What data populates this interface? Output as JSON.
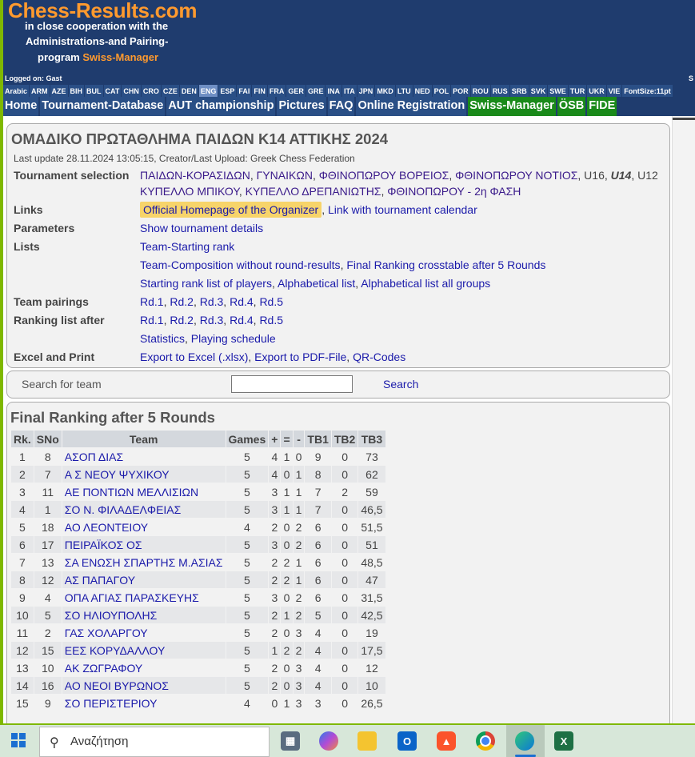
{
  "header": {
    "logo": "Chess-Results.com",
    "coop_line1": "in close cooperation with the",
    "coop_line2": "Administrations-and Pairing-",
    "coop_line3_pre": "program",
    "coop_line3_sm": "Swiss-Manager"
  },
  "login": {
    "left": "Logged on: Gast",
    "right": "S"
  },
  "languages": [
    "Arabic",
    "ARM",
    "AZE",
    "BIH",
    "BUL",
    "CAT",
    "CHN",
    "CRO",
    "CZE",
    "DEN",
    "ENG",
    "ESP",
    "FAI",
    "FIN",
    "FRA",
    "GER",
    "GRE",
    "INA",
    "ITA",
    "JPN",
    "MKD",
    "LTU",
    "NED",
    "POL",
    "POR",
    "ROU",
    "RUS",
    "SRB",
    "SVK",
    "SWE",
    "TUR",
    "UKR",
    "VIE",
    "FontSize:11pt"
  ],
  "active_language": "ENG",
  "nav": [
    {
      "label": "Home",
      "green": false
    },
    {
      "label": "Tournament-Database",
      "green": false
    },
    {
      "label": "AUT championship",
      "green": false
    },
    {
      "label": "Pictures",
      "green": false
    },
    {
      "label": "FAQ",
      "green": false
    },
    {
      "label": "Online Registration",
      "green": false
    },
    {
      "label": "Swiss-Manager",
      "green": true
    },
    {
      "label": "ÖSB",
      "green": true
    },
    {
      "label": "FIDE",
      "green": true
    }
  ],
  "tournament": {
    "title": "ΟΜΑΔΙΚΟ ΠΡΩΤΑΘΛΗΜΑ ΠΑΙΔΩΝ Κ14 ΑΤΤΙΚΗΣ 2024",
    "last_update": "Last update 28.11.2024 13:05:15, Creator/Last Upload: Greek Chess Federation",
    "labels": {
      "selection": "Tournament selection",
      "links": "Links",
      "parameters": "Parameters",
      "lists": "Lists",
      "pairings": "Team pairings",
      "ranking": "Ranking list after",
      "excel": "Excel and Print"
    },
    "selection_line1": [
      "ΠΑΙΔΩΝ-ΚΟΡΑΣΙΔΩΝ",
      "ΓΥΝΑΙΚΩΝ",
      "ΦΘΙΝΟΠΩΡΟΥ ΒΟΡΕΙΟΣ",
      "ΦΘΙΝΟΠΩΡΟΥ ΝΟΤΙΟΣ",
      "U16",
      "U14",
      "U12"
    ],
    "selection_line2": [
      "ΚΥΠΕΛΛΟ ΜΠΙΚΟΥ",
      "ΚΥΠΕΛΛΟ ΔΡΕΠΑΝΙΩΤΗΣ",
      "ΦΘΙΝΟΠΩΡΟΥ - 2η ΦΑΣΗ"
    ],
    "links": [
      "Official Homepage of the Organizer",
      "Link with tournament calendar"
    ],
    "parameters": "Show tournament details",
    "lists_line1": "Team-Starting rank",
    "lists_line2": [
      "Team-Composition without round-results",
      "Final Ranking crosstable after 5 Rounds"
    ],
    "lists_line3": [
      "Starting rank list of players",
      "Alphabetical list",
      "Alphabetical list all groups"
    ],
    "pairings": [
      "Rd.1",
      "Rd.2",
      "Rd.3",
      "Rd.4",
      "Rd.5"
    ],
    "ranking": [
      "Rd.1",
      "Rd.2",
      "Rd.3",
      "Rd.4",
      "Rd.5"
    ],
    "ranking_line2": [
      "Statistics",
      "Playing schedule"
    ],
    "excel": [
      "Export to Excel (.xlsx)",
      "Export to PDF-File",
      "QR-Codes"
    ]
  },
  "search": {
    "label": "Search for team",
    "value": "",
    "button": "Search"
  },
  "ranking_table": {
    "title": "Final Ranking after 5 Rounds",
    "headers": [
      "Rk.",
      "SNo",
      "Team",
      "Games",
      "+",
      "=",
      "-",
      "TB1",
      "TB2",
      "TB3"
    ],
    "rows": [
      [
        "1",
        "8",
        "ΑΣΟΠ ΔΙΑΣ",
        "5",
        "4",
        "1",
        "0",
        "9",
        "0",
        "73"
      ],
      [
        "2",
        "7",
        "Α Σ ΝΕΟΥ ΨΥΧΙΚΟΥ",
        "5",
        "4",
        "0",
        "1",
        "8",
        "0",
        "62"
      ],
      [
        "3",
        "11",
        "ΑΕ ΠΟΝΤΙΩΝ ΜΕΛΛΙΣΙΩΝ",
        "5",
        "3",
        "1",
        "1",
        "7",
        "2",
        "59"
      ],
      [
        "4",
        "1",
        "ΣΟ Ν. ΦΙΛΑΔΕΛΦΕΙΑΣ",
        "5",
        "3",
        "1",
        "1",
        "7",
        "0",
        "46,5"
      ],
      [
        "5",
        "18",
        "ΑΟ ΛΕΟΝΤΕΙΟΥ",
        "4",
        "2",
        "0",
        "2",
        "6",
        "0",
        "51,5"
      ],
      [
        "6",
        "17",
        "ΠΕΙΡΑΪΚΟΣ ΟΣ",
        "5",
        "3",
        "0",
        "2",
        "6",
        "0",
        "51"
      ],
      [
        "7",
        "13",
        "ΣΑ ΕΝΩΣΗ ΣΠΑΡΤΗΣ Μ.ΑΣΙΑΣ",
        "5",
        "2",
        "2",
        "1",
        "6",
        "0",
        "48,5"
      ],
      [
        "8",
        "12",
        "ΑΣ ΠΑΠΑΓΟΥ",
        "5",
        "2",
        "2",
        "1",
        "6",
        "0",
        "47"
      ],
      [
        "9",
        "4",
        "ΟΠΑ ΑΓΙΑΣ ΠΑΡΑΣΚΕΥΗΣ",
        "5",
        "3",
        "0",
        "2",
        "6",
        "0",
        "31,5"
      ],
      [
        "10",
        "5",
        "ΣΟ ΗΛΙΟΥΠΟΛΗΣ",
        "5",
        "2",
        "1",
        "2",
        "5",
        "0",
        "42,5"
      ],
      [
        "11",
        "2",
        "ΓΑΣ ΧΟΛΑΡΓΟΥ",
        "5",
        "2",
        "0",
        "3",
        "4",
        "0",
        "19"
      ],
      [
        "12",
        "15",
        "ΕΕΣ ΚΟΡΥΔΑΛΛΟΥ",
        "5",
        "1",
        "2",
        "2",
        "4",
        "0",
        "17,5"
      ],
      [
        "13",
        "10",
        "ΑΚ ΖΩΓΡΑΦΟΥ",
        "5",
        "2",
        "0",
        "3",
        "4",
        "0",
        "12"
      ],
      [
        "14",
        "16",
        "ΑΟ ΝΕΟΙ ΒΥΡΩΝΟΣ",
        "5",
        "2",
        "0",
        "3",
        "4",
        "0",
        "10"
      ],
      [
        "15",
        "9",
        "ΣΟ ΠΕΡΙΣΤΕΡΙΟΥ",
        "4",
        "0",
        "1",
        "3",
        "3",
        "0",
        "26,5"
      ]
    ]
  },
  "taskbar": {
    "search_placeholder": "Αναζήτηση",
    "icons": [
      "calculator-icon",
      "copilot-icon",
      "file-explorer-icon",
      "outlook-icon",
      "brave-icon",
      "chrome-icon",
      "edge-icon",
      "excel-icon"
    ]
  },
  "colors": {
    "header_bg": "#1f3c6e",
    "logo_orange": "#ff9a2e",
    "link_blue": "#1a1aaa",
    "nav_green": "#1a8a1a",
    "highlight": "#f7d46a"
  }
}
